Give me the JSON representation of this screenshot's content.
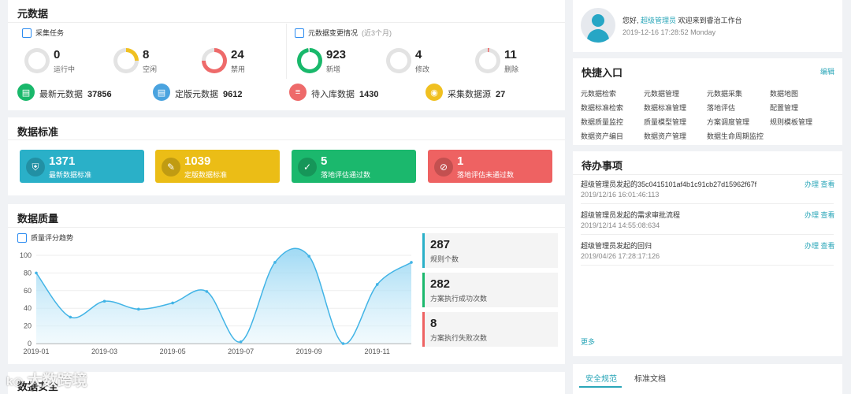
{
  "metadata": {
    "title": "元数据",
    "collection": {
      "title": "采集任务",
      "stats": [
        {
          "value": "0",
          "label": "运行中",
          "color": "#dddddd",
          "fraction": 0
        },
        {
          "value": "8",
          "label": "空闲",
          "color": "#f0c020",
          "fraction": 0.25
        },
        {
          "value": "24",
          "label": "禁用",
          "color": "#ee6a6a",
          "fraction": 0.75
        }
      ]
    },
    "changes": {
      "title": "元数据变更情况",
      "note": "(近3个月)",
      "stats": [
        {
          "value": "923",
          "label": "新增",
          "color": "#19b86b",
          "fraction": 0.98
        },
        {
          "value": "4",
          "label": "修改",
          "color": "#dddddd",
          "fraction": 0
        },
        {
          "value": "11",
          "label": "删除",
          "color": "#ee6a6a",
          "fraction": 0.02
        }
      ]
    },
    "totals": [
      {
        "label": "最新元数据",
        "value": "37856",
        "color": "#19b86b",
        "icon": "database-icon"
      },
      {
        "label": "定版元数据",
        "value": "9612",
        "color": "#4aa3df",
        "icon": "database-icon"
      },
      {
        "label": "待入库数据",
        "value": "1430",
        "color": "#ee6a6a",
        "icon": "file-icon"
      },
      {
        "label": "采集数据源",
        "value": "27",
        "color": "#f0c020",
        "icon": "datasource-icon"
      }
    ]
  },
  "standard": {
    "title": "数据标准",
    "cards": [
      {
        "value": "1371",
        "label": "最新数据标准",
        "color": "#2ab0c8",
        "icon": "shield-icon"
      },
      {
        "value": "1039",
        "label": "定版数据标准",
        "color": "#ebbd16",
        "icon": "edit-icon"
      },
      {
        "value": "5",
        "label": "落地评估通过数",
        "color": "#1bb86d",
        "icon": "check-icon"
      },
      {
        "value": "1",
        "label": "落地评估未通过数",
        "color": "#ee6262",
        "icon": "ban-icon"
      }
    ]
  },
  "quality": {
    "title": "数据质量",
    "trend_title": "质量评分趋势",
    "kpis": [
      {
        "value": "287",
        "label": "规则个数",
        "color": "#2ab0c8"
      },
      {
        "value": "282",
        "label": "方案执行成功次数",
        "color": "#1bb86d"
      },
      {
        "value": "8",
        "label": "方案执行失败次数",
        "color": "#ee6262"
      }
    ]
  },
  "chart_data": {
    "type": "area",
    "x": [
      "2019-01",
      "2019-02",
      "2019-03",
      "2019-04",
      "2019-05",
      "2019-06",
      "2019-07",
      "2019-08",
      "2019-09",
      "2019-10",
      "2019-11",
      "2019-12"
    ],
    "xticks": [
      "2019-01",
      "2019-03",
      "2019-05",
      "2019-07",
      "2019-09",
      "2019-11"
    ],
    "values": [
      80,
      30,
      48,
      39,
      46,
      59,
      2,
      92,
      99,
      0,
      67,
      92
    ],
    "ylim": [
      0,
      100
    ],
    "yticks": [
      0,
      20,
      40,
      60,
      80,
      100
    ],
    "color": "#42b4e6"
  },
  "security": {
    "title": "数据安全"
  },
  "welcome": {
    "greeting": "您好,",
    "user": "超级管理员",
    "message": "欢迎来到睿治工作台",
    "datetime": "2019-12-16 17:28:52 Monday"
  },
  "quick": {
    "title": "快捷入口",
    "edit": "编辑",
    "items": [
      "元数据检索",
      "元数据管理",
      "元数据采集",
      "数据地图",
      "数据标准检索",
      "数据标准管理",
      "落地评估",
      "配置管理",
      "数据质量监控",
      "质量模型管理",
      "方案调度管理",
      "规则模板管理",
      "数据资产编目",
      "数据资产管理",
      "数据生命周期监控"
    ]
  },
  "todo": {
    "title": "待办事项",
    "items": [
      {
        "title": "超级管理员发起的35c0415101af4b1c91cb27d15962f67f",
        "time": "2019/12/16 16:01:46:113",
        "actions": "办理 查看"
      },
      {
        "title": "超级管理员发起的需求审批流程",
        "time": "2019/12/14 14:55:08:634",
        "actions": "办理 查看"
      },
      {
        "title": "超级管理员发起的回归",
        "time": "2019/04/26 17:28:17:126",
        "actions": "办理 查看"
      }
    ],
    "more": "更多"
  },
  "tabs": {
    "items": [
      "安全规范",
      "标准文档"
    ]
  },
  "watermark": "大数跨境"
}
